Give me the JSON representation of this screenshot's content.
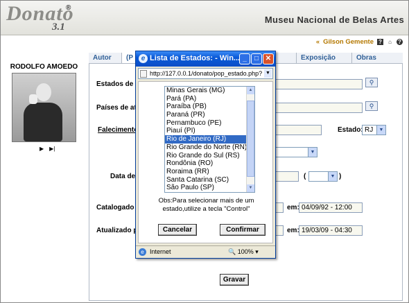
{
  "header": {
    "logo": "Donato",
    "registered": "®",
    "version": "3.1",
    "museum": "Museu Nacional de Belas Artes"
  },
  "user": {
    "prefix": "«",
    "name": "Gilson Gemente",
    "icons": [
      "help-icon",
      "home-icon",
      "info-icon"
    ]
  },
  "artist": {
    "name": "RODOLFO AMOEDO",
    "nav": [
      "▶",
      "▶|"
    ]
  },
  "tabs": [
    {
      "label": "Autor"
    },
    {
      "label": "(P"
    },
    {
      "label": ""
    },
    {
      "label": ""
    },
    {
      "label": "Exposição"
    },
    {
      "label": "Obras"
    }
  ],
  "form": {
    "estados_label": "Estados de a",
    "paises_label": "Países de atu",
    "falecimento_label": "Falecimento",
    "estado_label": "Estado:",
    "estado_value": "RJ",
    "data_label": "Data de t",
    "data_paren_open": "(",
    "data_paren_close": ")",
    "catalogado_label": "Catalogado p",
    "catalogado_em_label": "em:",
    "catalogado_em_value": "04/09/92 - 12:00",
    "atualizado_label": "Atualizado po",
    "atualizado_em_label": "em:",
    "atualizado_em_value": "19/03/09 - 04:30",
    "save_label": "Gravar"
  },
  "popup": {
    "title": "Lista de Estados: - Win...",
    "url": "http://127.0.0.1/donato/pop_estado.php?",
    "options": [
      "Minas Gerais (MG)",
      "Pará (PA)",
      "Paraíba (PB)",
      "Paraná (PR)",
      "Pernambuco (PE)",
      "Piauí (PI)",
      "Rio de Janeiro (RJ)",
      "Rio Grande do Norte (RN)",
      "Rio Grande do Sul (RS)",
      "Rondônia (RO)",
      "Roraima (RR)",
      "Santa Catarina (SC)",
      "São Paulo (SP)"
    ],
    "selected": "Rio de Janeiro (RJ)",
    "obs_line1": "Obs:Para selecionar mais de um",
    "obs_line2": "estado,utilize a tecla \"Control\"",
    "cancel_label": "Cancelar",
    "confirm_label": "Confirmar",
    "status_text": "Internet",
    "zoom": "100%"
  },
  "colors": {
    "accent": "#2f5f97",
    "title_bar": "#0a5ad8",
    "selection": "#316ac5",
    "user_name": "#b47800"
  }
}
